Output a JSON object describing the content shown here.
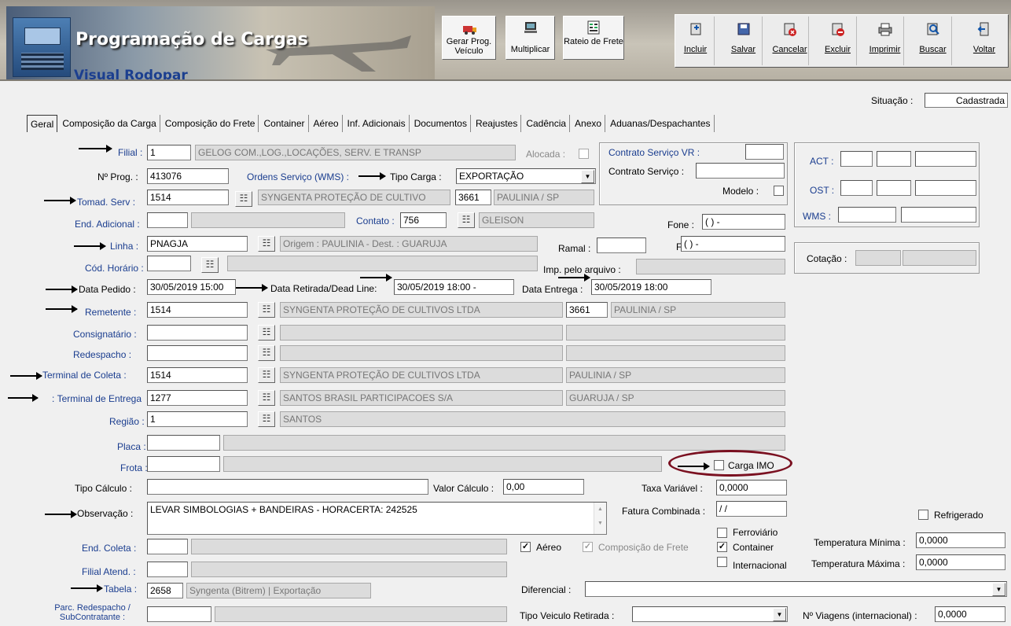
{
  "app": {
    "title": "Programação de Cargas",
    "subtitle": "Visual Rodopar"
  },
  "toolbar1": {
    "gerar": "Gerar Prog. Veículo",
    "multiplicar": "Multiplicar",
    "rateio": "Rateio de Frete"
  },
  "toolbar2": {
    "incluir": "Incluir",
    "salvar": "Salvar",
    "cancelar": "Cancelar",
    "excluir": "Excluir",
    "imprimir": "Imprimir",
    "buscar": "Buscar",
    "voltar": "Voltar"
  },
  "situacao": {
    "label": "Situação :",
    "value": "Cadastrada"
  },
  "tabs": [
    "Geral",
    "Composição da Carga",
    "Composição do Frete",
    "Container",
    "Aéreo",
    "Inf. Adicionais",
    "Documentos",
    "Reajustes",
    "Cadência",
    "Anexo",
    "Aduanas/Despachantes"
  ],
  "form": {
    "filial": {
      "label": "Filial :",
      "code": "1",
      "name": "GELOG COM.,LOG.,LOCAÇÕES, SERV. E TRANSP"
    },
    "alocada": "Alocada :",
    "nprog": {
      "label": "Nº Prog. :",
      "value": "413076"
    },
    "ordens": "Ordens Serviço (WMS) :",
    "tipo_carga": {
      "label": "Tipo Carga :",
      "value": "EXPORTAÇÃO"
    },
    "tomad": {
      "label": "Tomad. Serv :",
      "code": "1514",
      "name": "SYNGENTA PROTEÇÃO DE CULTIVO",
      "city_code": "3661",
      "city": "PAULINIA / SP"
    },
    "end_adicional": "End. Adicional :",
    "contato": {
      "label": "Contato :",
      "code": "756",
      "name": "GLEISON"
    },
    "fone": {
      "label": "Fone :",
      "value": "(  )    -"
    },
    "linha": {
      "label": "Linha :",
      "code": "PNAGJA",
      "desc": "Origem : PAULINIA  - Dest. : GUARUJA"
    },
    "ramal": "Ramal :",
    "fax": {
      "label": "Fax :",
      "value": "(  )    -"
    },
    "cod_horario": "Cód. Horário :",
    "imp_arquivo": "Imp. pelo arquivo :",
    "data_pedido": {
      "label": "Data Pedido :",
      "value": "30/05/2019 15:00"
    },
    "data_retirada": {
      "label": "Data Retirada/Dead Line:",
      "value": "30/05/2019 18:00 -"
    },
    "data_entrega": {
      "label": "Data Entrega :",
      "value": "30/05/2019 18:00"
    },
    "remetente": {
      "label": "Remetente :",
      "code": "1514",
      "name": "SYNGENTA PROTEÇÃO DE CULTIVOS LTDA",
      "city_code": "3661",
      "city": "PAULINIA / SP"
    },
    "consignatario": "Consignatário :",
    "redespacho": "Redespacho :",
    "terminal_coleta": {
      "label": "Terminal de Coleta :",
      "code": "1514",
      "name": "SYNGENTA PROTEÇÃO DE CULTIVOS LTDA",
      "city": "PAULINIA / SP"
    },
    "terminal_entrega": {
      "label": "Terminal de Entrega :",
      "code": "1277",
      "name": "SANTOS BRASIL PARTICIPACOES S/A",
      "city": "GUARUJA / SP"
    },
    "regiao": {
      "label": "Região :",
      "code": "1",
      "name": "SANTOS"
    },
    "placa": "Placa :",
    "frota": "Frota :",
    "carga_imo": "Carga IMO",
    "tipo_calculo": "Tipo Cálculo :",
    "valor_calculo": {
      "label": "Valor Cálculo :",
      "value": "0,00"
    },
    "taxa_variavel": {
      "label": "Taxa Variável :",
      "value": "0,0000"
    },
    "observacao": {
      "label": "Observação :",
      "value": "LEVAR SIMBOLOGIAS + BANDEIRAS - HORACERTA: 242525"
    },
    "fatura": {
      "label": "Fatura Combinada :",
      "value": "/  /"
    },
    "refrigerado": "Refrigerado",
    "ferroviario": "Ferroviário",
    "container": "Container",
    "internacional": "Internacional",
    "aereo": "Aéreo",
    "composicao_frete": "Composição de Frete",
    "temp_min": {
      "label": "Temperatura Mínima :",
      "value": "0,0000"
    },
    "temp_max": {
      "label": "Temperatura Máxima :",
      "value": "0,0000"
    },
    "end_coleta": "End. Coleta :",
    "filial_atend": "Filial Atend. :",
    "tabela": {
      "label": "Tabela :",
      "code": "2658",
      "name": "Syngenta (Bitrem) | Exportação"
    },
    "diferencial": "Diferencial :",
    "parc_redespacho": "Parc. Redespacho / SubContratante :",
    "tipo_veiculo": "Tipo Veiculo Retirada :",
    "nviagens": {
      "label": "Nº Viagens (internacional) :",
      "value": "0,0000"
    }
  },
  "panel_contrato": {
    "vr": "Contrato Serviço VR :",
    "servico": "Contrato Serviço :",
    "modelo": "Modelo :"
  },
  "panel_right": {
    "act": "ACT :",
    "ost": "OST :",
    "wms": "WMS :",
    "cotacao": "Cotação :"
  }
}
